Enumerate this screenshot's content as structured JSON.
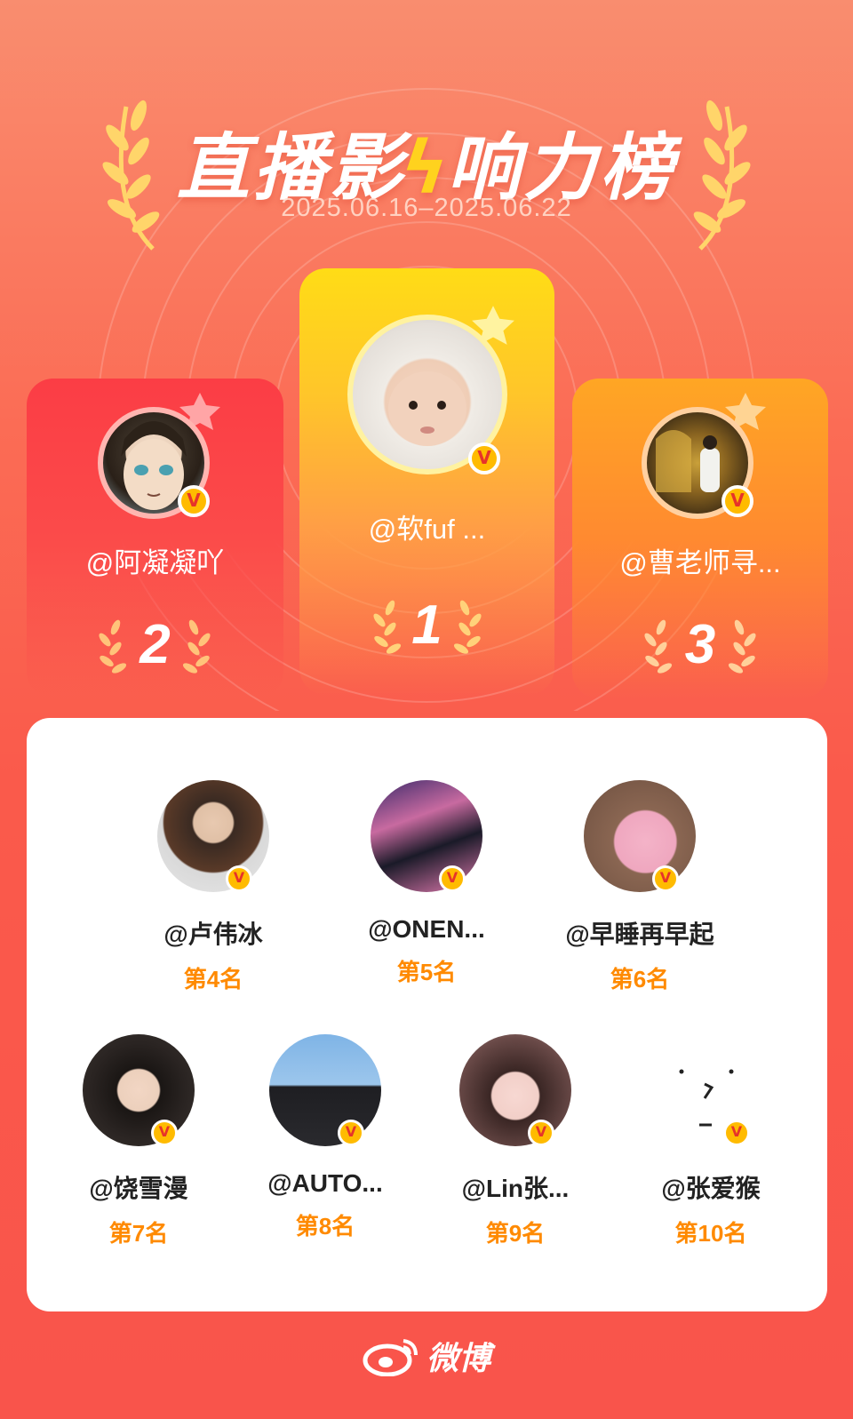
{
  "header": {
    "title_part1": "直播影",
    "title_bolt": "ϟ",
    "title_part2": "响力榜",
    "date_range": "2025.06.16–2025.06.22"
  },
  "podium": [
    {
      "rank": "1",
      "name": "@软fuf ..."
    },
    {
      "rank": "2",
      "name": "@阿凝凝吖"
    },
    {
      "rank": "3",
      "name": "@曹老师寻..."
    }
  ],
  "list": [
    {
      "name": "@卢伟冰",
      "rank": "第4名"
    },
    {
      "name": "@ONEN...",
      "rank": "第5名"
    },
    {
      "name": "@早睡再早起",
      "rank": "第6名"
    },
    {
      "name": "@饶雪漫",
      "rank": "第7名"
    },
    {
      "name": "@AUTO...",
      "rank": "第8名"
    },
    {
      "name": "@Lin张...",
      "rank": "第9名"
    },
    {
      "name": "@张爱猴",
      "rank": "第10名"
    }
  ],
  "footer": {
    "brand": "微博"
  },
  "badge": {
    "verified": "V"
  },
  "colors": {
    "accent_orange": "#ff8a00",
    "gold": "#ffd21e",
    "red": "#fb3d45",
    "verified_yellow": "#ffbb00"
  },
  "icons": [
    "laurel-icon",
    "crown-icon",
    "verified-badge-icon",
    "weibo-logo-icon"
  ]
}
